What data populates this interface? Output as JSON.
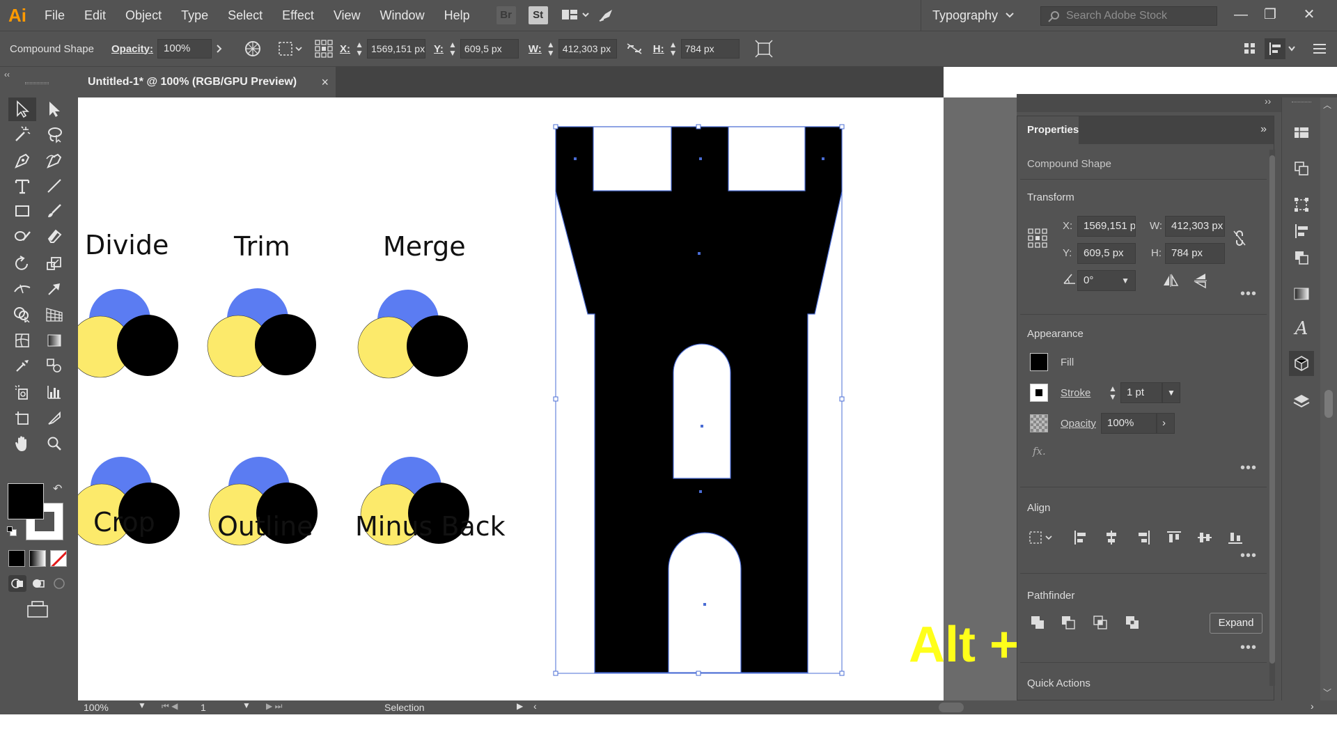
{
  "app": {
    "logo": "Ai",
    "menu": [
      "File",
      "Edit",
      "Object",
      "Type",
      "Select",
      "Effect",
      "View",
      "Window",
      "Help"
    ],
    "bridge_label": "Br",
    "stock_label": "St",
    "workspace": "Typography",
    "search_placeholder": "Search Adobe Stock"
  },
  "control_bar": {
    "selection_type": "Compound Shape",
    "opacity_label": "Opacity:",
    "opacity_value": "100%",
    "x_label": "X:",
    "x_value": "1569,151 px",
    "y_label": "Y:",
    "y_value": "609,5 px",
    "w_label": "W:",
    "w_value": "412,303 px",
    "h_label": "H:",
    "h_value": "784 px"
  },
  "document": {
    "tab_title": "Untitled-1* @ 100% (RGB/GPU Preview)",
    "close_glyph": "×"
  },
  "canvas": {
    "labels": [
      "Divide",
      "Trim",
      "Merge",
      "Crop",
      "Outline",
      "Minus Back"
    ],
    "overlay_text": "Alt +",
    "colors": {
      "blue": "#5b7cf2",
      "yellow": "#fcea6b",
      "black": "#000000",
      "selection": "#4a6cd4",
      "overlay": "#ffff1a"
    }
  },
  "status_bar": {
    "zoom": "100%",
    "artboard": "1",
    "tool": "Selection"
  },
  "properties": {
    "tab": "Properties",
    "object_type": "Compound Shape",
    "transform_title": "Transform",
    "x_label": "X:",
    "x_value": "1569,151 p",
    "y_label": "Y:",
    "y_value": "609,5 px",
    "w_label": "W:",
    "w_value": "412,303 px",
    "h_label": "H:",
    "h_value": "784 px",
    "angle_value": "0°",
    "appearance_title": "Appearance",
    "fill_label": "Fill",
    "stroke_label": "Stroke",
    "stroke_value": "1 pt",
    "opacity_label": "Opacity",
    "opacity_value": "100%",
    "fx_label": "fx.",
    "align_title": "Align",
    "pathfinder_title": "Pathfinder",
    "expand_label": "Expand",
    "quick_actions_title": "Quick Actions",
    "more_glyph": "•••"
  }
}
